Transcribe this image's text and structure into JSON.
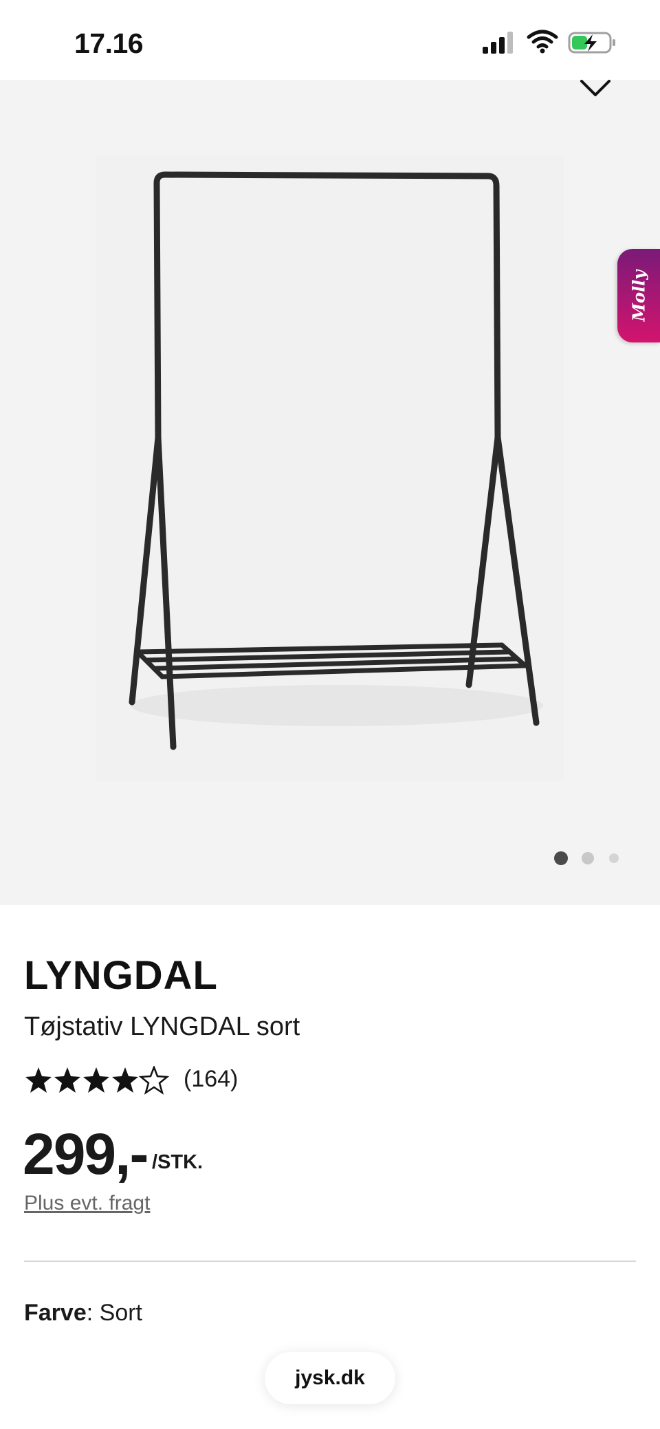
{
  "status_bar": {
    "time": "17.16",
    "icons": [
      "cellular-signal-icon",
      "wifi-icon",
      "battery-charging-icon"
    ]
  },
  "gallery": {
    "wishlist_icon": "heart-outline-icon",
    "chat_widget_label": "Molly",
    "active_image_index": 1,
    "image_count": 3
  },
  "product": {
    "brand": "LYNGDAL",
    "name": "Tøjstativ LYNGDAL sort",
    "rating": 4.5,
    "review_count": "(164)",
    "price": "299,-",
    "price_unit": "/STK.",
    "freight_note": "Plus evt. fragt",
    "color_label": "Farve",
    "color_separator": ": ",
    "color_value": "Sort"
  },
  "browser": {
    "url": "jysk.dk"
  },
  "colors": {
    "gallery_background": "#f3f3f3",
    "chat_gradient_start": "#7a1a78",
    "chat_gradient_end": "#d4146e",
    "battery_fill": "#34c759"
  }
}
